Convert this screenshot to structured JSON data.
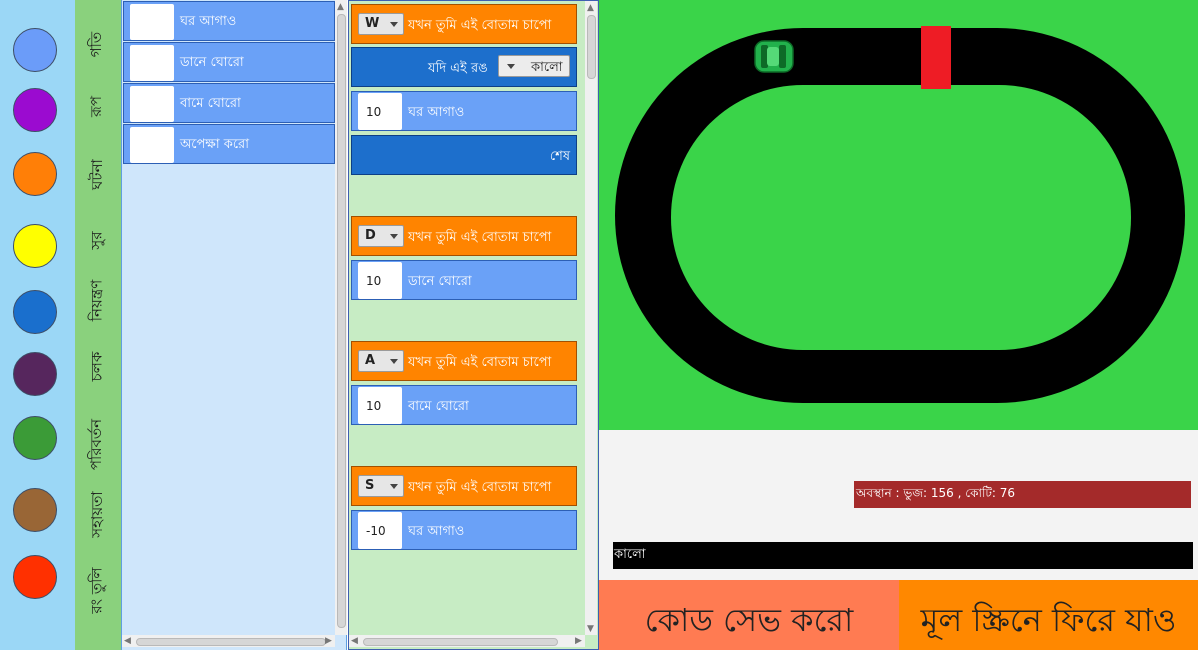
{
  "palette": {
    "colors": [
      "#6b9cf9",
      "#9b0bd0",
      "#ff7f07",
      "#ffff00",
      "#1a6fcd",
      "#56265d",
      "#3b9b37",
      "#996636",
      "#ff3000"
    ]
  },
  "categories": [
    "গতি",
    "রূপ",
    "ঘটনা",
    "সুর",
    "নিয়ন্ত্রণ",
    "চলক",
    "পরিবর্তন",
    "সহায়তা",
    "রং তুলি"
  ],
  "library": {
    "blocks": [
      {
        "label": "ঘর আগাও"
      },
      {
        "label": "ডানে ঘোরো"
      },
      {
        "label": "বামে ঘোরো"
      },
      {
        "label": "অপেক্ষা করো"
      }
    ]
  },
  "workspace": {
    "scripts": [
      {
        "key": "W",
        "event_label": "যখন তুমি এই বোতাম চাপো",
        "condition": {
          "label": "যদি এই রঙ",
          "color": "কালো"
        },
        "step": {
          "value": "10",
          "label": "ঘর আগাও"
        },
        "end_label": "শেষ"
      },
      {
        "key": "D",
        "event_label": "যখন তুমি এই বোতাম চাপো",
        "step": {
          "value": "10",
          "label": "ডানে ঘোরো"
        }
      },
      {
        "key": "A",
        "event_label": "যখন তুমি এই বোতাম চাপো",
        "step": {
          "value": "10",
          "label": "বামে ঘোরো"
        }
      },
      {
        "key": "S",
        "event_label": "যখন তুমি এই বোতাম চাপো",
        "step": {
          "value": "-10",
          "label": "ঘর আগাও"
        }
      }
    ]
  },
  "stage": {
    "background_color": "#3ad449",
    "track_color": "#000000",
    "finish_color": "#ee1c25",
    "car_color": "#22b14c"
  },
  "status": {
    "position_text": "অবস্থান : ভুজ: 156 , কোটি: 76",
    "color_text": "কালো"
  },
  "buttons": {
    "save": "কোড সেভ করো",
    "back": "মূল স্ক্রিনে ফিরে যাও"
  }
}
